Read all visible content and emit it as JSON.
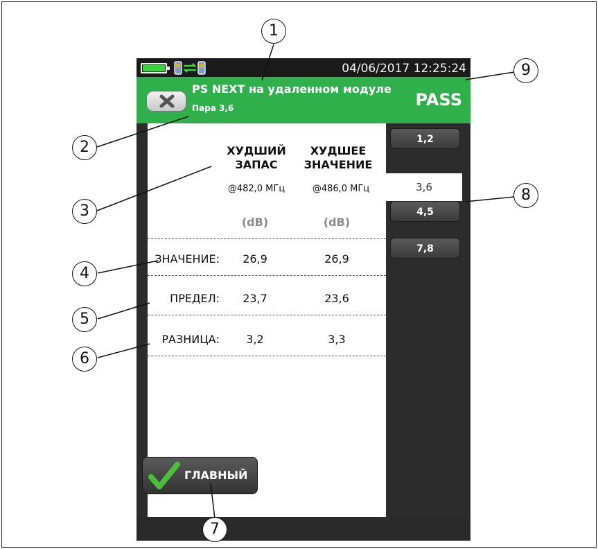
{
  "status_bar": {
    "datetime": "04/06/2017 12:25:24"
  },
  "header": {
    "title": "PS NEXT на удаленном модуле",
    "subtitle": "Пара 3,6",
    "result": "PASS"
  },
  "table": {
    "columns": [
      {
        "heading_line1": "ХУДШИЙ",
        "heading_line2": "ЗАПАС",
        "frequency": "@482,0 МГц",
        "unit": "(dB)"
      },
      {
        "heading_line1": "ХУДШЕЕ",
        "heading_line2": "ЗНАЧЕНИЕ",
        "frequency": "@486,0 МГц",
        "unit": "(dB)"
      }
    ],
    "rows": [
      {
        "label": "ЗНАЧЕНИЕ:",
        "values": [
          "26,9",
          "26,9"
        ]
      },
      {
        "label": "ПРЕДЕЛ:",
        "values": [
          "23,7",
          "23,6"
        ]
      },
      {
        "label": "РАЗНИЦА:",
        "values": [
          "3,2",
          "3,3"
        ]
      }
    ]
  },
  "pair_tabs": [
    {
      "label": "1,2",
      "active": false
    },
    {
      "label": "3,6",
      "active": true
    },
    {
      "label": "4,5",
      "active": false
    },
    {
      "label": "7,8",
      "active": false
    }
  ],
  "footer": {
    "home_label": "ГЛАВНЫЙ"
  },
  "callouts": [
    "1",
    "2",
    "3",
    "4",
    "5",
    "6",
    "7",
    "8",
    "9"
  ],
  "icons": {
    "battery": "battery-icon",
    "link": "link-status-icon",
    "close": "close-icon",
    "home": "checkmark-icon"
  },
  "colors": {
    "header_green": "#2fb04a",
    "battery_green": "#3cd33c",
    "check_green": "#4cbf3a"
  }
}
